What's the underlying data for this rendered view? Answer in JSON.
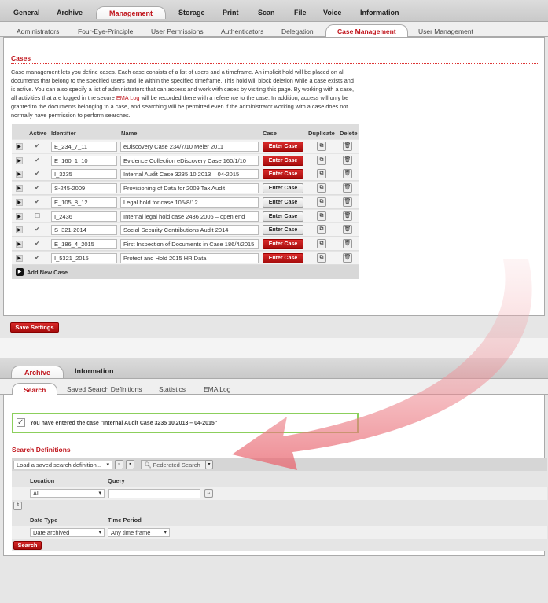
{
  "top": {
    "main_tabs": [
      "General",
      "Archive",
      "Management",
      "Storage",
      "Print",
      "Scan",
      "File",
      "Voice",
      "Information"
    ],
    "sub_tabs": [
      "Administrators",
      "Four-Eye-Principle",
      "User Permissions",
      "Authenticators",
      "Delegation",
      "Case Management",
      "User Management"
    ],
    "section_title": "Cases",
    "description_pre": "Case management lets you define cases. Each case consists of a list of users and a timeframe. An implicit hold will be placed on all documents that belong to the specified users and lie within the specified timeframe. This hold will block deletion while a case exists and is active. You can also specify a list of administrators that can access and work with cases by visiting this page. By working with a case, all activities that are logged in the secure ",
    "description_link": "EMA Log",
    "description_post": " will be recorded there with a reference to the case. In addition, access will only be granted to the documents belonging to a case, and searching will be permitted even if the administrator working with a case does not normally have permission to perform searches.",
    "columns": [
      "Active",
      "Identifier",
      "Name",
      "Case",
      "Duplicate",
      "Delete"
    ],
    "cases": [
      {
        "active": true,
        "id": "E_234_7_11",
        "name": "eDiscovery Case 234/7/10 Meier 2011",
        "button": "Enter Case",
        "highlight": true
      },
      {
        "active": true,
        "id": "E_160_1_10",
        "name": "Evidence Collection eDiscovery Case 160/1/10",
        "button": "Enter Case",
        "highlight": true
      },
      {
        "active": true,
        "id": "I_3235",
        "name": "Internal Audit Case 3235 10.2013 – 04-2015",
        "button": "Enter Case",
        "highlight": true
      },
      {
        "active": true,
        "id": "S-245-2009",
        "name": "Provisioning of Data for 2009 Tax Audit",
        "button": "Enter Case",
        "highlight": false
      },
      {
        "active": true,
        "id": "E_105_8_12",
        "name": "Legal hold for case 105/8/12",
        "button": "Enter Case",
        "highlight": false
      },
      {
        "active": false,
        "id": "I_2436",
        "name": "Internal legal hold case 2436 2006 – open end",
        "button": "Enter Case",
        "highlight": false
      },
      {
        "active": true,
        "id": "S_321-2014",
        "name": "Social Security Contributions Audit 2014",
        "button": "Enter Case",
        "highlight": false
      },
      {
        "active": true,
        "id": "E_186_4_2015",
        "name": "First Inspection of Documents in Case 186/4/2015",
        "button": "Enter Case",
        "highlight": true
      },
      {
        "active": true,
        "id": "I_5321_2015",
        "name": "Protect and Hold 2015 HR Data",
        "button": "Enter Case",
        "highlight": true
      }
    ],
    "add_new": "Add New Case",
    "save": "Save Settings"
  },
  "bottom": {
    "main_tabs": [
      "Archive",
      "Information"
    ],
    "sub_tabs": [
      "Search",
      "Saved Search Definitions",
      "Statistics",
      "EMA Log"
    ],
    "notice": "You have entered the case \"Internal Audit Case 3235 10.2013 – 04-2015\"",
    "section_title": "Search Definitions",
    "load_placeholder": "Load a saved search definition...",
    "federated": "Federated Search",
    "location_label": "Location",
    "query_label": "Query",
    "location_value": "All",
    "date_type_label": "Date Type",
    "time_period_label": "Time Period",
    "date_type_value": "Date archived",
    "time_period_value": "Any time frame",
    "search": "Search"
  },
  "colors": {
    "accent": "#c0141b",
    "notice_border": "#7cc34a"
  }
}
